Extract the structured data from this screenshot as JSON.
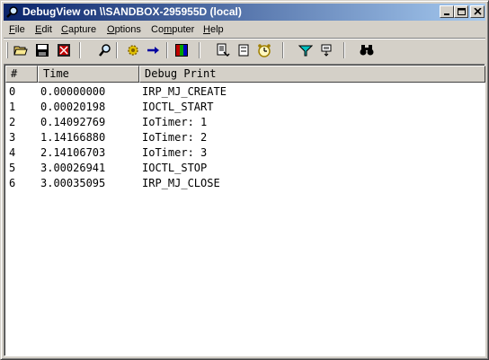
{
  "window": {
    "title": "DebugView on \\\\SANDBOX-295955D (local)",
    "app_icon": "magnifier-icon",
    "controls": [
      "minimize-icon",
      "maximize-icon",
      "close-icon"
    ]
  },
  "menu": {
    "items": [
      {
        "label": "File",
        "accel": "F",
        "rest": "ile"
      },
      {
        "label": "Edit",
        "accel": "E",
        "rest": "dit"
      },
      {
        "label": "Capture",
        "accel": "C",
        "rest": "apture"
      },
      {
        "label": "Options",
        "accel": "O",
        "rest": "ptions"
      },
      {
        "label": "Computer",
        "pre": "Co",
        "accel": "m",
        "rest": "puter"
      },
      {
        "label": "Help",
        "accel": "H",
        "rest": "elp"
      }
    ]
  },
  "toolbar": {
    "icons": [
      "open-folder-icon",
      "save-disk-icon",
      "clear-display-icon",
      "find-icon",
      "capture-gear-icon",
      "autoscroll-arrow-icon",
      "log-to-file-icon",
      "copy-icon",
      "history-icon",
      "clock-icon",
      "filter-icon",
      "highlight-icon",
      "search-binoculars-icon"
    ]
  },
  "table": {
    "columns": [
      "#",
      "Time",
      "Debug Print"
    ],
    "rows": [
      {
        "num": "0",
        "time": "0.00000000",
        "msg": "IRP_MJ_CREATE"
      },
      {
        "num": "1",
        "time": "0.00020198",
        "msg": "IOCTL_START"
      },
      {
        "num": "2",
        "time": "0.14092769",
        "msg": "IoTimer: 1"
      },
      {
        "num": "3",
        "time": "1.14166880",
        "msg": "IoTimer: 2"
      },
      {
        "num": "4",
        "time": "2.14106703",
        "msg": "IoTimer: 3"
      },
      {
        "num": "5",
        "time": "3.00026941",
        "msg": "IOCTL_STOP"
      },
      {
        "num": "6",
        "time": "3.00035095",
        "msg": "IRP_MJ_CLOSE"
      }
    ]
  }
}
